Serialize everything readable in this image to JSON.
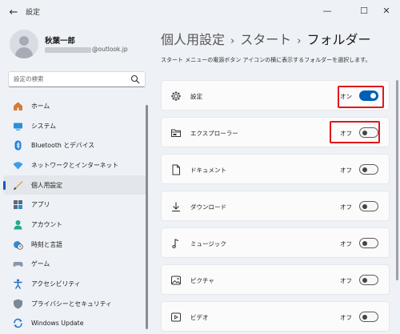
{
  "window": {
    "title": "設定",
    "back_glyph": "←",
    "minimize_glyph": "—",
    "maximize_glyph": "☐",
    "close_glyph": "✕"
  },
  "user": {
    "name": "秋葉一郎",
    "email_suffix": "@outlook.jp"
  },
  "search": {
    "placeholder": "設定の検索"
  },
  "sidebar": {
    "items": [
      {
        "label": "ホーム",
        "icon": "home-icon"
      },
      {
        "label": "システム",
        "icon": "system-icon"
      },
      {
        "label": "Bluetooth とデバイス",
        "icon": "bluetooth-icon"
      },
      {
        "label": "ネットワークとインターネット",
        "icon": "network-icon"
      },
      {
        "label": "個人用設定",
        "icon": "personalization-icon",
        "active": true
      },
      {
        "label": "アプリ",
        "icon": "apps-icon"
      },
      {
        "label": "アカウント",
        "icon": "account-icon"
      },
      {
        "label": "時刻と言語",
        "icon": "time-language-icon"
      },
      {
        "label": "ゲーム",
        "icon": "gaming-icon"
      },
      {
        "label": "アクセシビリティ",
        "icon": "accessibility-icon"
      },
      {
        "label": "プライバシーとセキュリティ",
        "icon": "privacy-icon"
      },
      {
        "label": "Windows Update",
        "icon": "windows-update-icon"
      }
    ]
  },
  "breadcrumb": {
    "level1": "個人用設定",
    "level2": "スタート",
    "current": "フォルダー",
    "separator": "›"
  },
  "description": "スタート メニューの電源ボタン アイコンの横に表示するフォルダーを選択します。",
  "folders": [
    {
      "label": "設定",
      "state": "オン",
      "on": true,
      "icon": "settings-gear-icon",
      "highlighted": true
    },
    {
      "label": "エクスプローラー",
      "state": "オフ",
      "on": false,
      "icon": "file-explorer-icon",
      "highlighted": true
    },
    {
      "label": "ドキュメント",
      "state": "オフ",
      "on": false,
      "icon": "document-icon"
    },
    {
      "label": "ダウンロード",
      "state": "オフ",
      "on": false,
      "icon": "download-icon"
    },
    {
      "label": "ミュージック",
      "state": "オフ",
      "on": false,
      "icon": "music-icon"
    },
    {
      "label": "ピクチャ",
      "state": "オフ",
      "on": false,
      "icon": "picture-icon"
    },
    {
      "label": "ビデオ",
      "state": "オフ",
      "on": false,
      "icon": "video-icon"
    }
  ],
  "colors": {
    "accent": "#005fb8",
    "highlight": "#e0171c",
    "background": "#eef1f6"
  }
}
